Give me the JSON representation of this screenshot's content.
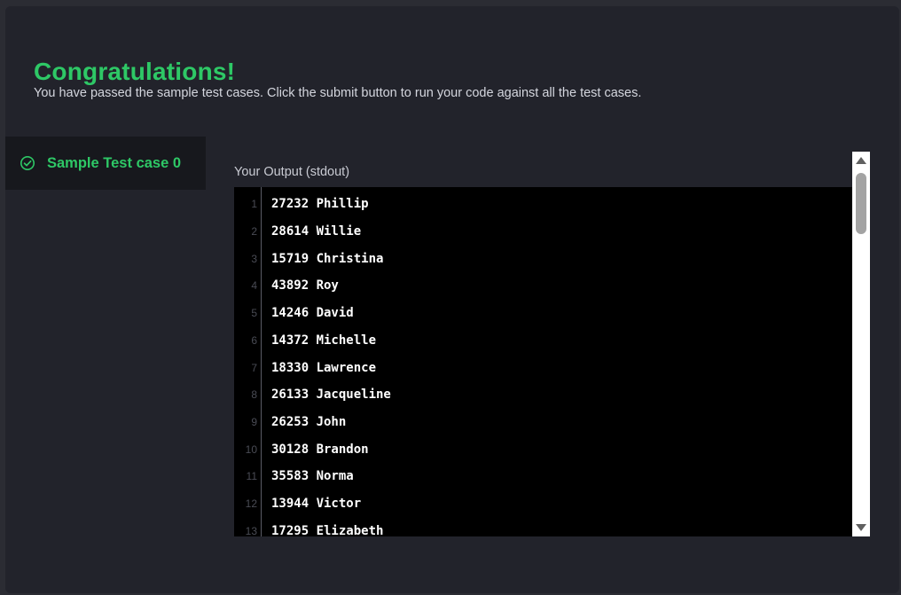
{
  "header": {
    "title": "Congratulations!",
    "subtitle": "You have passed the sample test cases. Click the submit button to run your code against all the test cases."
  },
  "tabs": [
    {
      "label": "Sample Test case 0",
      "icon": "check-circle-icon",
      "status": "passed"
    }
  ],
  "output": {
    "label": "Your Output (stdout)",
    "lines": [
      {
        "n": "1",
        "text": "27232 Phillip"
      },
      {
        "n": "2",
        "text": "28614 Willie"
      },
      {
        "n": "3",
        "text": "15719 Christina"
      },
      {
        "n": "4",
        "text": "43892 Roy"
      },
      {
        "n": "5",
        "text": "14246 David"
      },
      {
        "n": "6",
        "text": "14372 Michelle"
      },
      {
        "n": "7",
        "text": "18330 Lawrence"
      },
      {
        "n": "8",
        "text": "26133 Jacqueline"
      },
      {
        "n": "9",
        "text": "26253 John"
      },
      {
        "n": "10",
        "text": "30128 Brandon"
      },
      {
        "n": "11",
        "text": "35583 Norma"
      },
      {
        "n": "12",
        "text": "13944 Victor"
      },
      {
        "n": "13",
        "text": "17295 Elizabeth"
      }
    ]
  },
  "colors": {
    "accent_green": "#2ec866",
    "panel_bg": "#22232b",
    "console_bg": "#000000"
  }
}
